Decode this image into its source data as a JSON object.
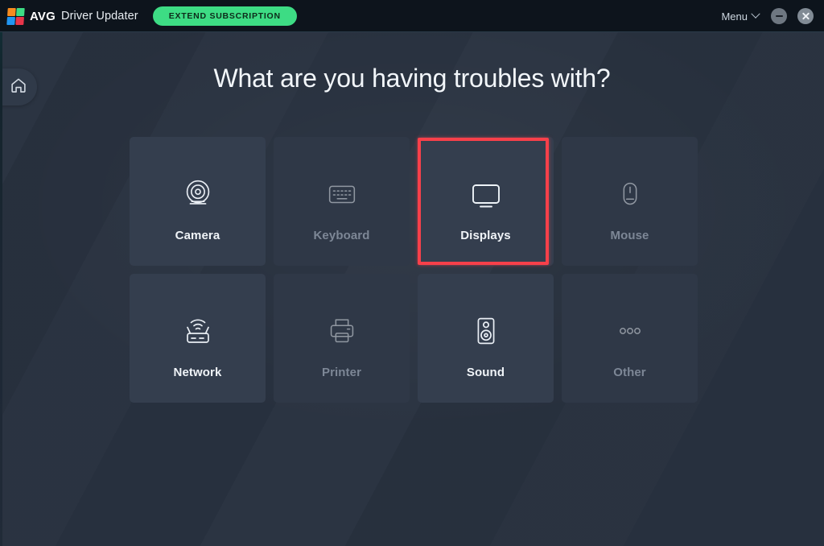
{
  "window": {
    "brand_avg": "AVG",
    "brand_product": "Driver Updater",
    "extend_label": "EXTEND SUBSCRIPTION",
    "menu_label": "Menu",
    "minimize_icon": "minimize-icon",
    "close_icon": "close-icon",
    "chevron_icon": "chevron-down-icon",
    "accent_green": "#3ddc84",
    "titlebar_bg": "#0d141c",
    "page_bg": "#28313f"
  },
  "sidebar": {
    "home_icon": "home-icon",
    "home_label": "Home"
  },
  "main": {
    "heading": "What are you having troubles with?",
    "highlight_color": "#f8404a",
    "highlighted_tile": "Displays",
    "tiles": [
      {
        "label": "Camera",
        "icon": "webcam-icon",
        "enabled": true
      },
      {
        "label": "Keyboard",
        "icon": "keyboard-icon",
        "enabled": false
      },
      {
        "label": "Displays",
        "icon": "monitor-icon",
        "enabled": true
      },
      {
        "label": "Mouse",
        "icon": "mouse-icon",
        "enabled": false
      },
      {
        "label": "Network",
        "icon": "router-icon",
        "enabled": true
      },
      {
        "label": "Printer",
        "icon": "printer-icon",
        "enabled": false
      },
      {
        "label": "Sound",
        "icon": "speaker-icon",
        "enabled": true
      },
      {
        "label": "Other",
        "icon": "ellipsis-icon",
        "enabled": false
      }
    ]
  }
}
